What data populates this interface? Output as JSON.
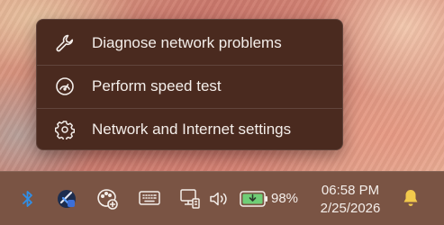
{
  "menu": {
    "items": [
      {
        "label": "Diagnose network problems",
        "icon": "wrench-icon"
      },
      {
        "label": "Perform speed test",
        "icon": "speedometer-icon"
      },
      {
        "label": "Network and Internet settings",
        "icon": "gear-icon"
      }
    ]
  },
  "taskbar": {
    "tray_icons": [
      "bluetooth-icon",
      "vpn-shield-icon",
      "palette-icon",
      "keyboard-icon",
      "network-icon",
      "volume-icon",
      "battery-charging-icon"
    ],
    "battery_percent": "98%",
    "time": "06:58 PM",
    "date": "2/25/2026",
    "notification_icon": "bell-icon"
  },
  "colors": {
    "menu_background": "#4a2a1f",
    "taskbar_background": "#7a5444",
    "bluetooth_blue": "#2f8fe8",
    "battery_green": "#6fce76",
    "bell_yellow": "#f2c94c"
  }
}
